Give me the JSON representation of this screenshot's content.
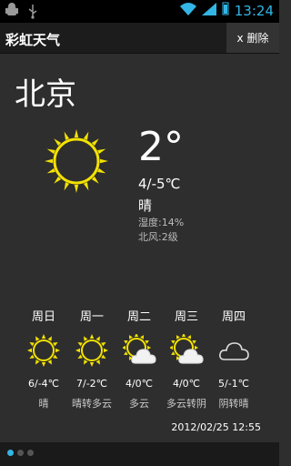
{
  "status_bar": {
    "time": "13:24"
  },
  "app": {
    "title": "彩虹天气",
    "delete_label": "x 删除"
  },
  "current": {
    "city": "北京",
    "temp": "2°",
    "range": "4/-5℃",
    "condition": "晴",
    "humidity": "湿度:14%",
    "wind": "北风:2级",
    "icon": "sun-icon"
  },
  "forecast": [
    {
      "day": "周日",
      "range": "6/-4℃",
      "condition": "晴",
      "icon": "sun-icon"
    },
    {
      "day": "周一",
      "range": "7/-2℃",
      "condition": "晴转多云",
      "icon": "sun-icon"
    },
    {
      "day": "周二",
      "range": "4/0℃",
      "condition": "多云",
      "icon": "sun-cloud-icon"
    },
    {
      "day": "周三",
      "range": "4/0℃",
      "condition": "多云转阴",
      "icon": "sun-cloud-icon"
    },
    {
      "day": "周四",
      "range": "5/-1℃",
      "condition": "阴转晴",
      "icon": "cloud-icon"
    }
  ],
  "updated": "2012/02/25 12:55",
  "pager": {
    "active_page": 1,
    "page_count": 3
  }
}
